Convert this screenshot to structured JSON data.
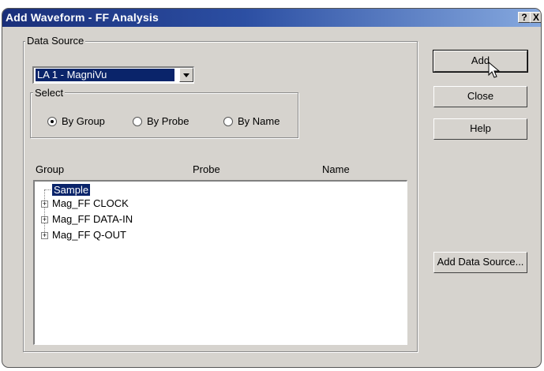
{
  "window": {
    "title": "Add Waveform - FF Analysis",
    "help_glyph": "?",
    "close_glyph": "X"
  },
  "data_source": {
    "legend": "Data Source",
    "selected": "LA 1 - MagniVu"
  },
  "select": {
    "legend": "Select",
    "options": [
      {
        "label": "By Group",
        "checked": true
      },
      {
        "label": "By Probe",
        "checked": false
      },
      {
        "label": "By Name",
        "checked": false
      }
    ]
  },
  "columns": [
    "Group",
    "Probe",
    "Name"
  ],
  "tree": [
    {
      "label": "Sample",
      "selected": true,
      "expandable": false
    },
    {
      "label": "Mag_FF CLOCK",
      "selected": false,
      "expandable": true
    },
    {
      "label": "Mag_FF DATA-IN",
      "selected": false,
      "expandable": true
    },
    {
      "label": "Mag_FF Q-OUT",
      "selected": false,
      "expandable": true
    }
  ],
  "buttons": {
    "add": "Add",
    "close": "Close",
    "help": "Help",
    "add_data_source": "Add Data Source..."
  }
}
